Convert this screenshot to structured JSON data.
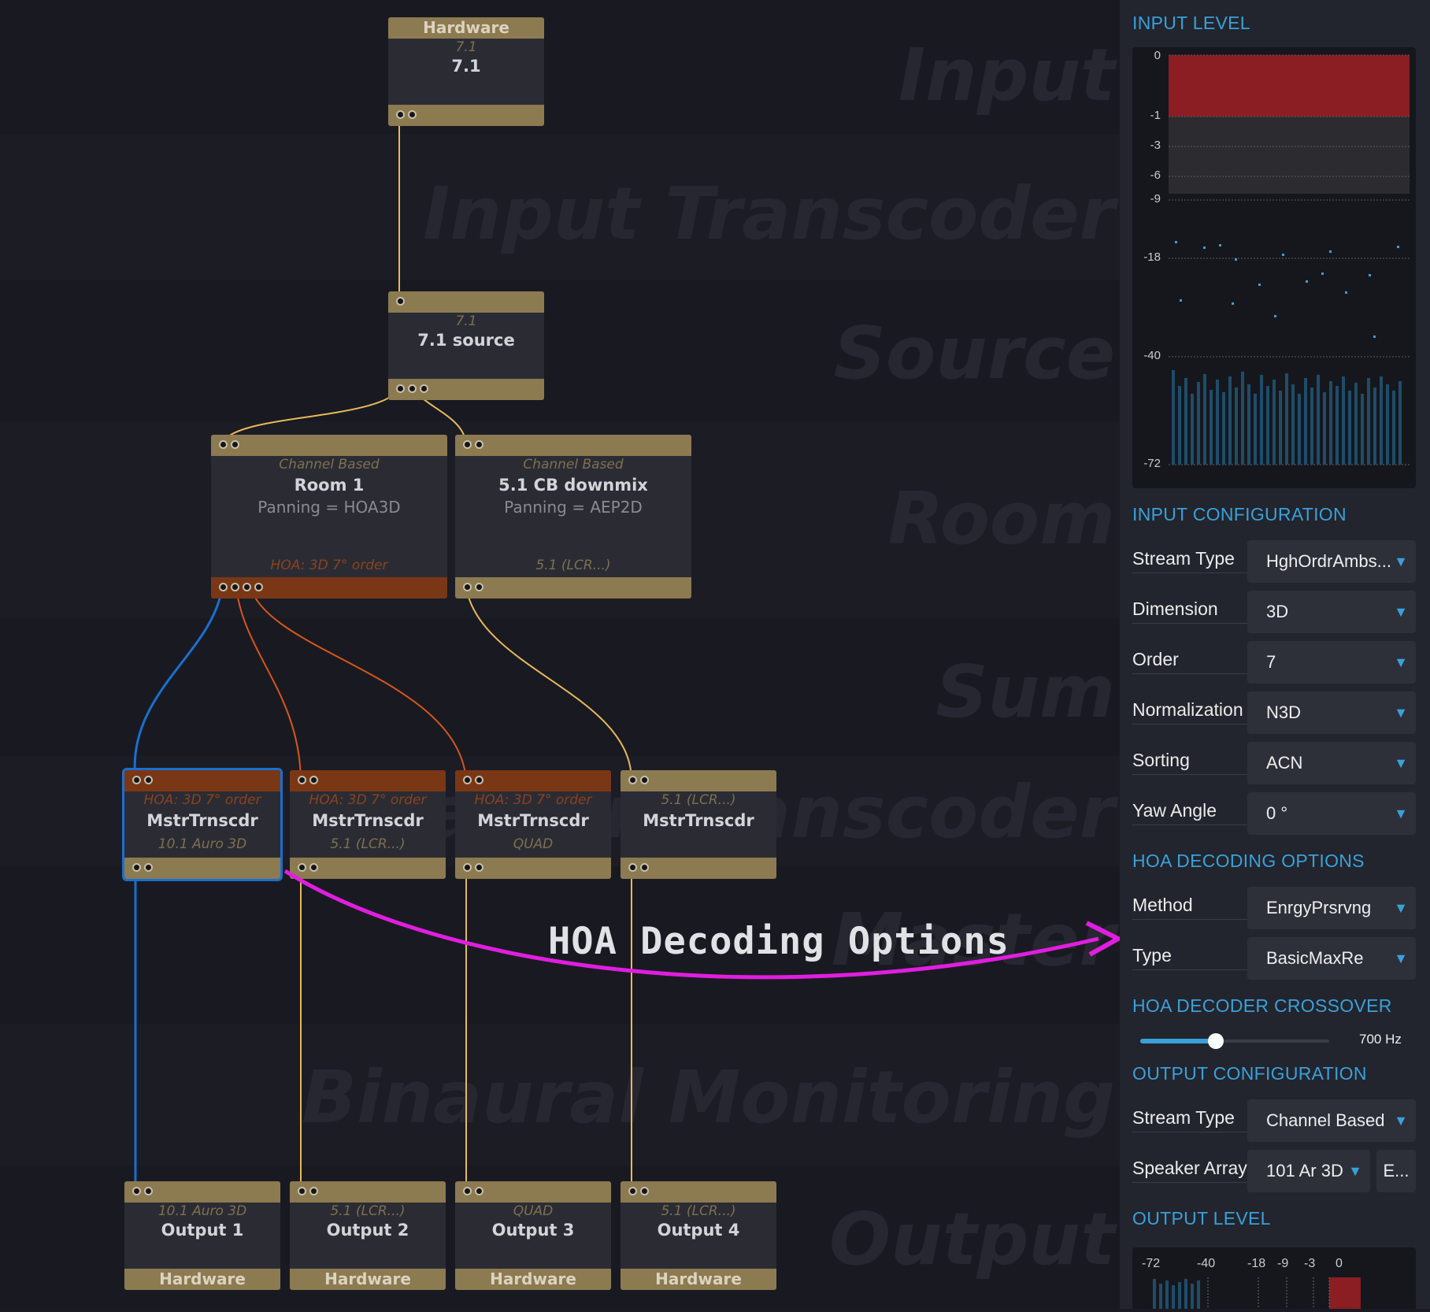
{
  "bands": [
    "Input",
    "Input Transcoder",
    "Source",
    "Room",
    "Sum",
    "Master Transcoder",
    "Master",
    "Binaural Monitoring",
    "Output"
  ],
  "nodes": {
    "hardware_in": {
      "bar": "Hardware",
      "sub": "7.1",
      "title": "7.1"
    },
    "source": {
      "sub": "7.1",
      "title": "7.1 source"
    },
    "room1": {
      "sub": "Channel Based",
      "title": "Room 1",
      "panning": "Panning = HOA3D",
      "format": "HOA: 3D 7° order"
    },
    "downmix": {
      "sub": "Channel Based",
      "title": "5.1 CB downmix",
      "panning": "Panning = AEP2D",
      "format": "5.1 (LCR...)"
    },
    "mt1": {
      "in_format": "HOA: 3D 7° order",
      "title": "MstrTrnscdr",
      "out_format": "10.1 Auro 3D"
    },
    "mt2": {
      "in_format": "HOA: 3D 7° order",
      "title": "MstrTrnscdr",
      "out_format": "5.1 (LCR...)"
    },
    "mt3": {
      "in_format": "HOA: 3D 7° order",
      "title": "MstrTrnscdr",
      "out_format": "QUAD"
    },
    "mt4": {
      "in_format": "5.1 (LCR...)",
      "title": "MstrTrnscdr",
      "out_format": ""
    },
    "out1": {
      "sub": "10.1 Auro 3D",
      "title": "Output 1",
      "bar": "Hardware"
    },
    "out2": {
      "sub": "5.1 (LCR...)",
      "title": "Output 2",
      "bar": "Hardware"
    },
    "out3": {
      "sub": "QUAD",
      "title": "Output 3",
      "bar": "Hardware"
    },
    "out4": {
      "sub": "5.1 (LCR...)",
      "title": "Output 4",
      "bar": "Hardware"
    }
  },
  "annotation": "HOA Decoding Options",
  "colors": {
    "accent": "#3aa0da",
    "hoa_wire": "#d7561c",
    "cb_wire": "#e8b95a",
    "selected_wire": "#1a6fd0",
    "annotation_arrow": "#e01ee0"
  },
  "panel": {
    "input_level": {
      "title": "INPUT LEVEL",
      "ticks": [
        "0",
        "-1",
        "-3",
        "-6",
        "-9",
        "-18",
        "-40",
        "-72"
      ]
    },
    "input_config": {
      "title": "INPUT CONFIGURATION",
      "stream_type": {
        "label": "Stream Type",
        "value": "HghOrdrAmbs..."
      },
      "dimension": {
        "label": "Dimension",
        "value": "3D"
      },
      "order": {
        "label": "Order",
        "value": "7"
      },
      "normalization": {
        "label": "Normalization",
        "value": "N3D"
      },
      "sorting": {
        "label": "Sorting",
        "value": "ACN"
      },
      "yaw": {
        "label": "Yaw Angle",
        "value": "0 °"
      }
    },
    "hoa_decoding": {
      "title": "HOA DECODING OPTIONS",
      "method": {
        "label": "Method",
        "value": "EnrgyPrsrvng"
      },
      "type": {
        "label": "Type",
        "value": "BasicMaxRe"
      }
    },
    "crossover": {
      "title": "HOA DECODER CROSSOVER",
      "value_label": "700 Hz",
      "fraction": 0.4
    },
    "output_config": {
      "title": "OUTPUT CONFIGURATION",
      "stream_type": {
        "label": "Stream Type",
        "value": "Channel Based"
      },
      "speaker_array": {
        "label": "Speaker Array",
        "value": "101 Ar 3D",
        "button": "E..."
      }
    },
    "output_level": {
      "title": "OUTPUT LEVEL",
      "ticks": [
        "-72",
        "-40",
        "-18",
        "-9",
        "-3",
        "0"
      ]
    }
  }
}
